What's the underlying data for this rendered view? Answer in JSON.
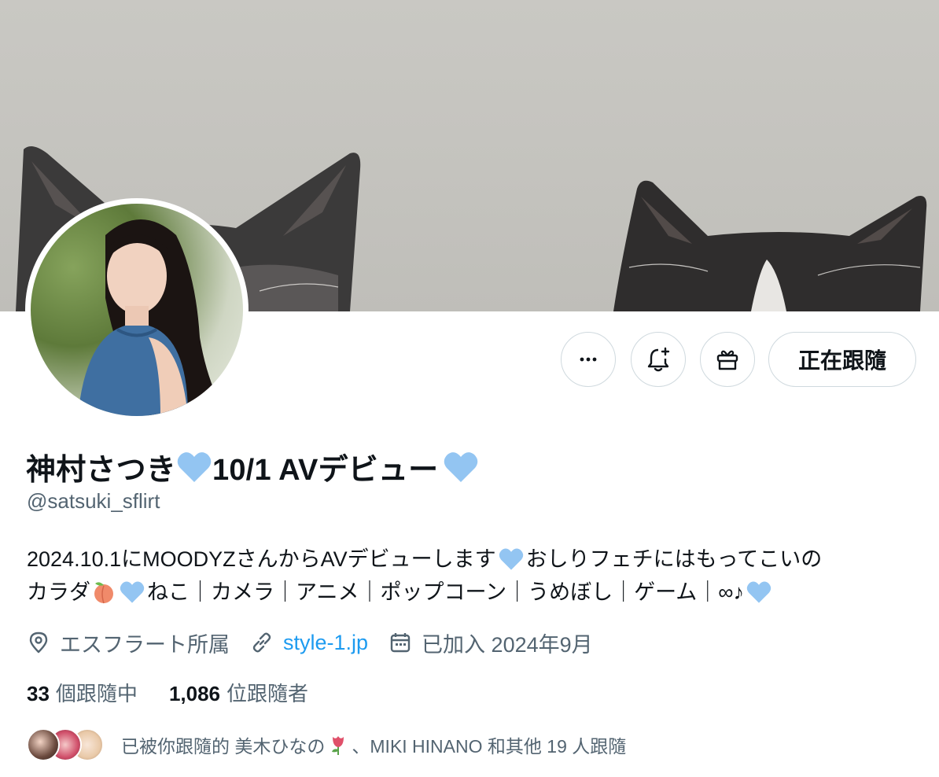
{
  "profile": {
    "name_part1": "神村さつき",
    "name_part2": "10/1 AVデビュー",
    "handle": "@satsuki_sflirt",
    "bio_line1_a": "2024.10.1にMOODYZさんからAVデビューします",
    "bio_line1_b": "おしりフェチにはもってこいの",
    "bio_line2_a": "カラダ",
    "bio_line2_b": "ねこ｜カメラ｜アニメ｜ポップコーン｜うめぼし｜ゲーム｜∞♪",
    "location": "エスフラート所属",
    "website": "style-1.jp",
    "joined": "已加入 2024年9月"
  },
  "actions": {
    "follow_label": "正在跟隨",
    "more_icon": "more-icon",
    "notify_icon": "bell-plus-icon",
    "gift_icon": "gift-icon"
  },
  "stats": {
    "following_count": "33",
    "following_label": "個跟隨中",
    "followers_count": "1,086",
    "followers_label": "位跟隨者"
  },
  "followed_by": {
    "prefix": "已被你跟隨的 美木ひなの",
    "suffix": "、MIKI HINANO 和其他 19 人跟隨"
  },
  "colors": {
    "heart": "#93c5f2",
    "link": "#1d9bf0",
    "secondary_text": "#536471",
    "border": "#cfd9de"
  }
}
